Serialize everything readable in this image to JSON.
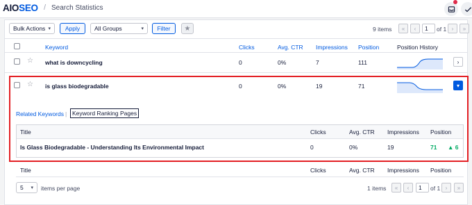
{
  "header": {
    "logo_main": "AIO",
    "logo_accent": "SEO",
    "separator": "/",
    "breadcrumb": "Search Statistics"
  },
  "toolbar": {
    "bulk_actions": "Bulk Actions",
    "apply": "Apply",
    "all_groups": "All Groups",
    "filter": "Filter",
    "items_count": "9 items",
    "current_page": "1",
    "of_pages": "of 1"
  },
  "table": {
    "columns": {
      "keyword": "Keyword",
      "clicks": "Clicks",
      "avg_ctr": "Avg. CTR",
      "impressions": "Impressions",
      "position": "Position",
      "position_history": "Position History"
    },
    "rows": [
      {
        "keyword": "what is downcycling",
        "clicks": "0",
        "ctr": "0%",
        "impressions": "7",
        "position": "111"
      },
      {
        "keyword": "is glass biodegradable",
        "clicks": "0",
        "ctr": "0%",
        "impressions": "19",
        "position": "71"
      }
    ]
  },
  "expanded": {
    "tab_related": "Related Keywords",
    "tab_sep": "|",
    "tab_ranking": "Keyword Ranking Pages",
    "columns": {
      "title": "Title",
      "clicks": "Clicks",
      "avg_ctr": "Avg. CTR",
      "impressions": "Impressions",
      "position": "Position"
    },
    "row": {
      "title": "Is Glass Biodegradable - Understanding Its Environmental Impact",
      "clicks": "0",
      "ctr": "0%",
      "impressions": "19",
      "position": "71",
      "change": "6"
    }
  },
  "footer": {
    "columns": {
      "title": "Title",
      "clicks": "Clicks",
      "avg_ctr": "Avg. CTR",
      "impressions": "Impressions",
      "position": "Position"
    },
    "per_page_value": "5",
    "per_page_label": "items per page",
    "items_count": "1 items",
    "current_page": "1",
    "of_pages": "of 1"
  },
  "colors": {
    "brand_blue": "#005ae0",
    "highlight_red": "#e31e23",
    "positive_green": "#00aa63"
  }
}
